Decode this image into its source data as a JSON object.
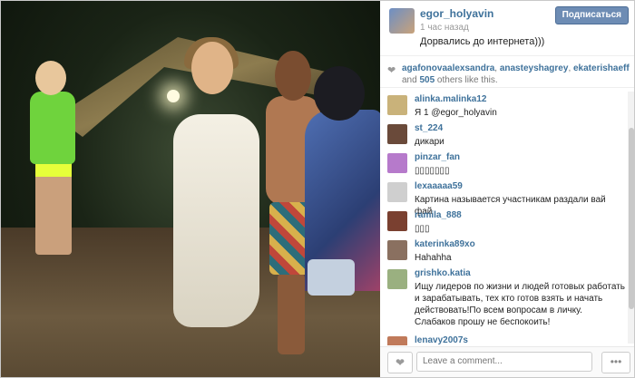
{
  "post": {
    "owner": "egor_holyavin",
    "time": "1 час назад",
    "caption": "Дорвались до интернета)))",
    "follow_label": "Подписаться"
  },
  "likes": {
    "users": [
      "agafonovaalexsandra",
      "anasteyshagrey",
      "ekaterishaeff"
    ],
    "separator_1": ", ",
    "separator_2": ", ",
    "and_text": " and ",
    "count": "505",
    "suffix": " others like this."
  },
  "comments": [
    {
      "user": "alinka.malinka12",
      "text": "Я 1 @egor_holyavin",
      "avatar_color": "#c9b27a"
    },
    {
      "user": "st_224",
      "text": "дикари",
      "avatar_color": "#6a4a3a"
    },
    {
      "user": "pinzar_fan",
      "text": "▯▯▯▯▯▯▯",
      "avatar_color": "#b67acb"
    },
    {
      "user": "lexaaaaa59",
      "text": "Картина называется участникам раздали вай фай",
      "avatar_color": "#cfcfcf"
    },
    {
      "user": "ramila_888",
      "text": "▯▯▯",
      "avatar_color": "#7a4030"
    },
    {
      "user": "katerinka89xo",
      "text": "Hahahha",
      "avatar_color": "#8a7060"
    },
    {
      "user": "grishko.katia",
      "text": "Ищу лидеров по жизни и людей готовых работать и зарабатывать, тех кто готов взять и начать действовать!По всем вопросам в личку. Слабаков прошу не беспокоить!",
      "avatar_color": "#9ab080"
    },
    {
      "user": "lenavy2007s",
      "text": "",
      "avatar_color": "#c07a5a"
    }
  ],
  "footer": {
    "input_placeholder": "Leave a comment...",
    "more_label": "•••"
  },
  "icons": {
    "like": "heart-icon",
    "more": "ellipsis-icon"
  },
  "colors": {
    "link": "#3f729b",
    "follow": "#6d8cb4"
  }
}
